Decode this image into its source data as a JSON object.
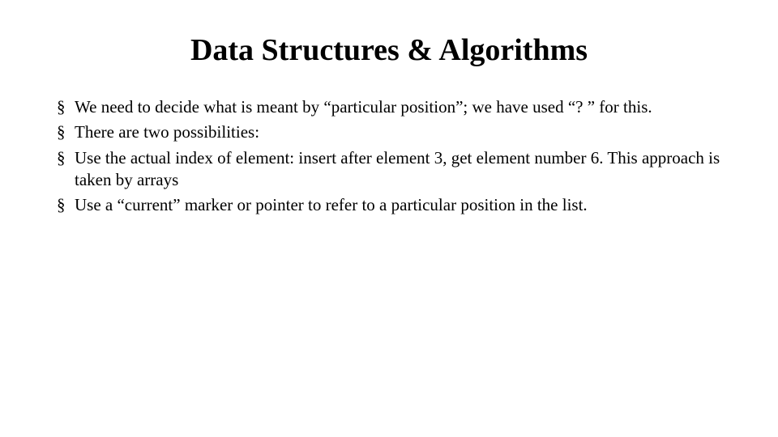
{
  "title": "Data Structures & Algorithms",
  "bullets": {
    "b1": "We need to decide what is meant by “particular position”; we have used “? ” for this.",
    "b2": "There are two possibilities:",
    "b3": "Use the actual index of element: insert after element 3, get element number 6. This approach is taken by arrays",
    "b4": "Use a “current” marker or pointer to refer to a particular position in the list."
  }
}
